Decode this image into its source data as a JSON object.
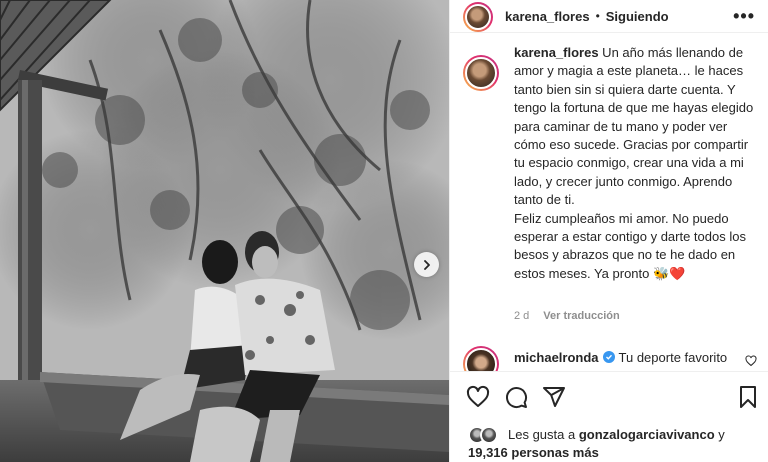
{
  "post": {
    "image": {
      "alt_icon": "image-carousel-next-icon"
    },
    "author": {
      "username": "karena_flores",
      "separator": "•",
      "follow_status": "Siguiendo",
      "more_label": "•••"
    },
    "caption": {
      "username": "karena_flores",
      "text_lines": [
        " Un año más llenando de amor y magia a este planeta… le haces tanto bien sin si quiera darte cuenta. Y tengo la fortuna de que me hayas elegido para caminar de tu mano y poder ver cómo eso sucede. Gracias por compartir tu espacio conmigo, crear una vida a mi lado, y crecer junto conmigo. Aprendo tanto de ti.",
        "Feliz cumpleaños mi amor. No puedo esperar a estar contigo y darte todos los besos y abrazos que no te he dado en estos meses. Ya pronto "
      ],
      "emojis": "🐝❤️",
      "age": "2 d",
      "translate_label": "Ver traducción"
    },
    "comment": {
      "username": "michaelronda",
      "verified": true,
      "text": "Tu deporte favorito"
    },
    "actions": [
      "heart-icon",
      "comment-icon",
      "share-icon",
      "save-icon"
    ],
    "likes": {
      "prefix": "Les gusta a ",
      "user": "gonzalogarciavivanco",
      "suffix": " y",
      "count_text": "19,316 personas más"
    }
  },
  "colors": {
    "text": "#262626",
    "muted": "#8e8e8e",
    "verified": "#3897f0",
    "divider": "#efefef"
  }
}
